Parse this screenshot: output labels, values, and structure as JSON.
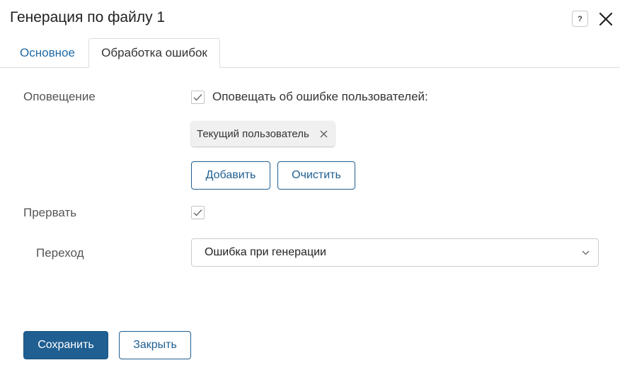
{
  "dialog": {
    "title": "Генерация по файлу 1",
    "help_icon": "question-icon",
    "close_icon": "close-icon"
  },
  "tabs": [
    {
      "label": "Основное",
      "active": false
    },
    {
      "label": "Обработка ошибок",
      "active": true
    }
  ],
  "notification": {
    "label": "Оповещение",
    "checkbox_checked": true,
    "checkbox_label": "Оповещать об ошибке пользователей:",
    "users": [
      {
        "name": "Текущий пользователь"
      }
    ],
    "add_button": "Добавить",
    "clear_button": "Очистить"
  },
  "interrupt": {
    "label": "Прервать",
    "checkbox_checked": true
  },
  "transition": {
    "label": "Переход",
    "selected_value": "Ошибка при генерации"
  },
  "footer": {
    "save_button": "Сохранить",
    "close_button": "Закрыть"
  },
  "colors": {
    "accent": "#1f5f92",
    "tab_link": "#1f6aa5"
  }
}
